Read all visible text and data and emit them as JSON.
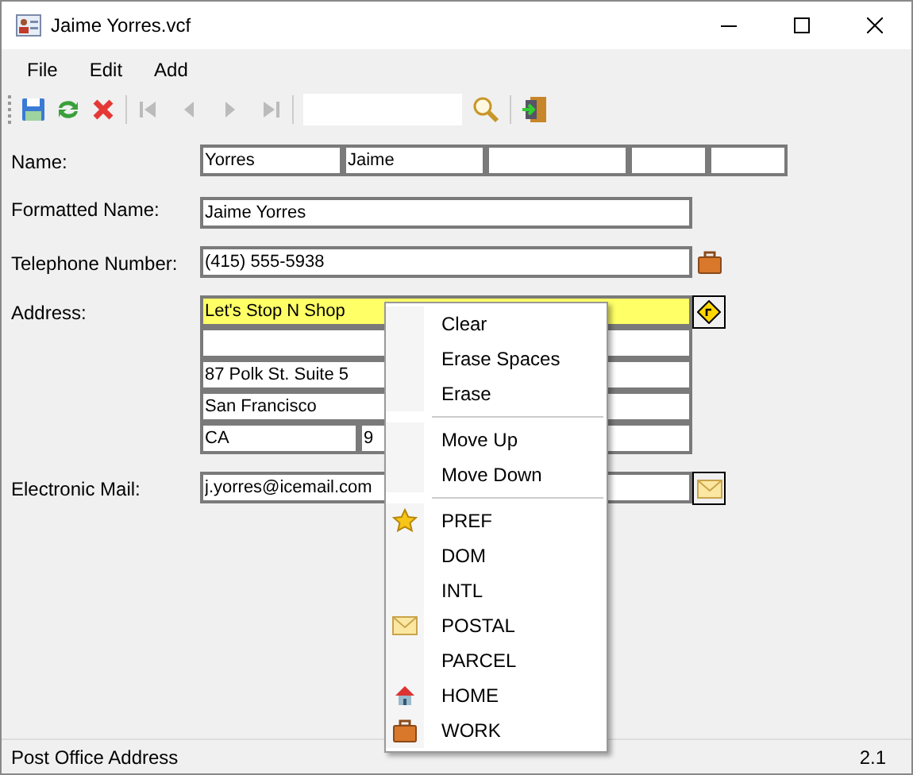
{
  "window": {
    "title": "Jaime Yorres.vcf"
  },
  "menubar": [
    "File",
    "Edit",
    "Add"
  ],
  "form": {
    "name": {
      "label": "Name:",
      "parts": [
        "Yorres",
        "Jaime"
      ]
    },
    "formatted_name": {
      "label": "Formatted Name:",
      "value": "Jaime Yorres"
    },
    "telephone": {
      "label": "Telephone Number:",
      "value": "(415) 555-5938"
    },
    "address": {
      "label": "Address:",
      "lines": [
        {
          "value": "Let's Stop N Shop",
          "selected": true
        },
        {
          "selected": false
        },
        {
          "value": "87 Polk St. Suite 5",
          "selected": false
        },
        {
          "value": "San Francisco",
          "selected": false
        }
      ],
      "region": "CA",
      "postal_code": "9"
    },
    "email": {
      "label": "Electronic Mail:",
      "value": "j.yorres@icemail.com"
    }
  },
  "context_menu": {
    "groups": [
      [
        {
          "label": "Clear",
          "kind": "plain"
        },
        {
          "label": "Erase Spaces",
          "kind": "plain"
        },
        {
          "label": "Erase",
          "kind": "plain"
        }
      ],
      [
        {
          "label": "Move Up",
          "kind": "plain"
        },
        {
          "label": "Move Down",
          "kind": "plain"
        }
      ],
      [
        {
          "label": "PREF",
          "kind": "star"
        },
        {
          "label": "DOM",
          "kind": "plain"
        },
        {
          "label": "INTL",
          "kind": "plain"
        },
        {
          "label": "POSTAL",
          "kind": "mail"
        },
        {
          "label": "PARCEL",
          "kind": "plain"
        },
        {
          "label": "HOME",
          "kind": "house"
        },
        {
          "label": "WORK",
          "kind": "case"
        }
      ]
    ]
  },
  "status_bar": {
    "text": "Post Office Address",
    "version": "2.1"
  }
}
